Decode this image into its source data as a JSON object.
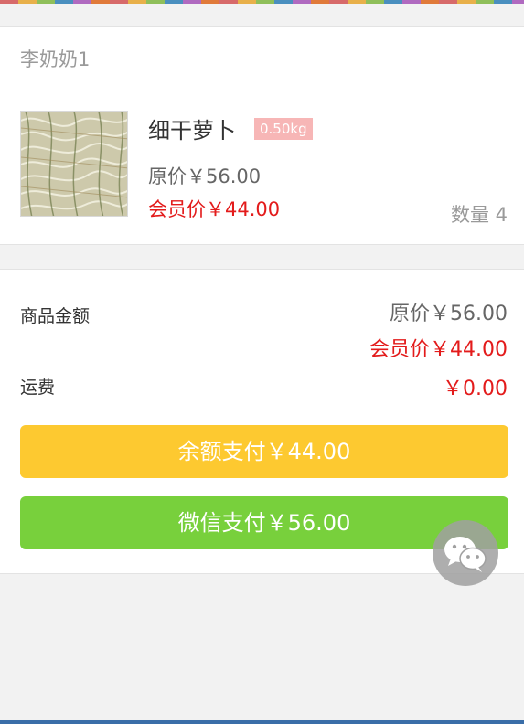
{
  "customer": {
    "name": "李奶奶1"
  },
  "product": {
    "title": "细干萝卜",
    "weight": "0.50kg",
    "original_price": "原价￥56.00",
    "member_price": "会员价￥44.00",
    "quantity": "数量 4",
    "thumbnail_icon": "dried-radish-image"
  },
  "summary": {
    "goods_amount_label": "商品金额",
    "goods_original": "原价￥56.00",
    "goods_member": "会员价￥44.00",
    "shipping_label": "运费",
    "shipping_value": "￥0.00"
  },
  "actions": {
    "balance_pay": "余额支付￥44.00",
    "wechat_pay": "微信支付￥56.00"
  },
  "fab": {
    "icon": "wechat-icon"
  },
  "colors": {
    "member_red": "#e31b1b",
    "balance_button": "#fdc930",
    "wechat_button": "#78d03c",
    "badge_pink": "#f7b6b6"
  }
}
